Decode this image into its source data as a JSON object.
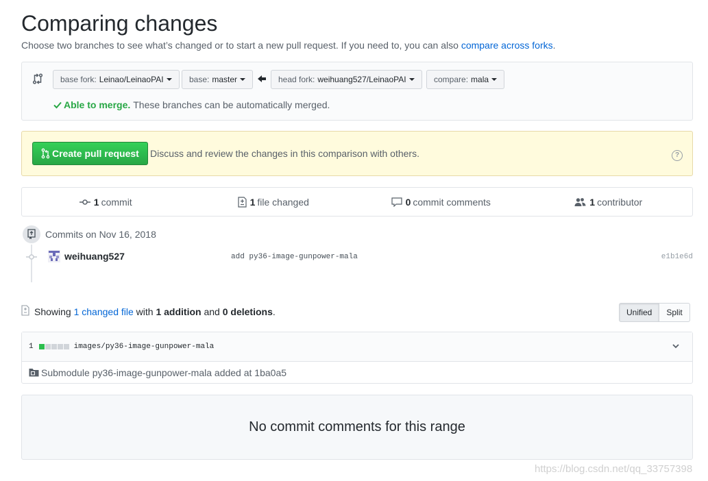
{
  "header": {
    "title": "Comparing changes",
    "description": "Choose two branches to see what’s changed or to start a new pull request. If you need to, you can also",
    "link": "compare across forks",
    "period": "."
  },
  "range": {
    "base_fork_label": "base fork:",
    "base_fork_value": "Leinao/LeinaoPAI",
    "base_label": "base:",
    "base_value": "master",
    "head_fork_label": "head fork:",
    "head_fork_value": "weihuang527/LeinaoPAI",
    "compare_label": "compare:",
    "compare_value": "mala",
    "merge_status": "Able to merge.",
    "merge_text": "These branches can be automatically merged."
  },
  "pull_request": {
    "button_label": "Create pull request",
    "text": "Discuss and review the changes in this comparison with others.",
    "help": "?"
  },
  "stats": {
    "commits_count": "1",
    "commits_label": "commit",
    "files_count": "1",
    "files_label": "file changed",
    "comments_count": "0",
    "comments_label": "commit comments",
    "contributors_count": "1",
    "contributors_label": "contributor"
  },
  "commits": {
    "date_heading": "Commits on Nov 16, 2018",
    "items": [
      {
        "author": "weihuang527",
        "message": "add py36-image-gunpower-mala",
        "sha": "e1b1e6d"
      }
    ]
  },
  "files_summary": {
    "showing": "Showing",
    "changed_link": "1 changed file",
    "with": "with",
    "additions": "1 addition",
    "and": "and",
    "deletions": "0 deletions",
    "end": ".",
    "unified_label": "Unified",
    "split_label": "Split"
  },
  "file": {
    "count": "1",
    "path": "images/py36-image-gunpower-mala",
    "diffstat": {
      "additions": 1,
      "blocks": 5
    },
    "body": "Submodule py36-image-gunpower-mala added at 1ba0a5"
  },
  "comments": {
    "empty_text": "No commit comments for this range"
  },
  "watermark": "https://blog.csdn.net/qq_33757398",
  "colors": {
    "link": "#0366d6",
    "success": "#28a745",
    "pr_bg": "#fffbdd"
  }
}
